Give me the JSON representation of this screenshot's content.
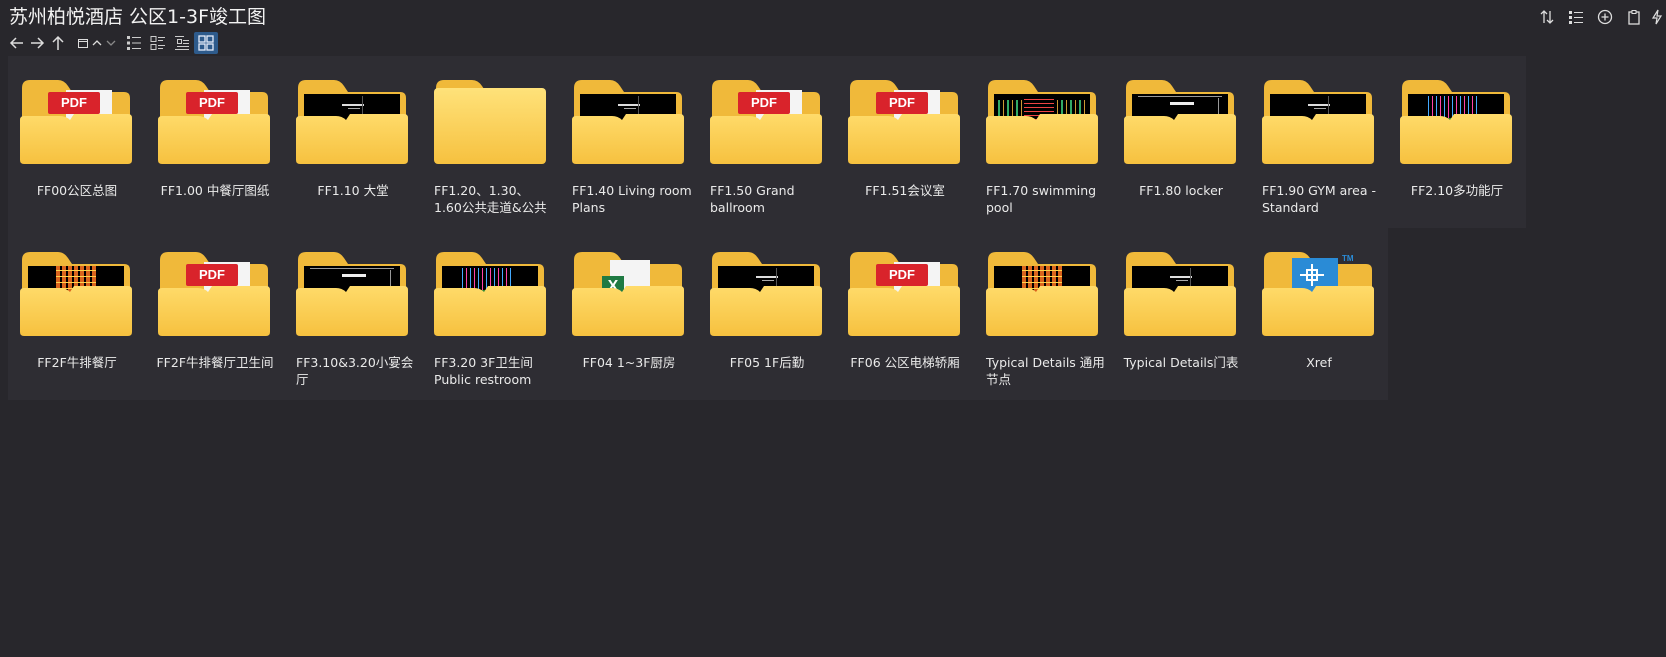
{
  "window": {
    "title": "苏州柏悦酒店 公区1-3F竣工图"
  },
  "navbar": {
    "back_icon": "arrow-left-icon",
    "forward_icon": "arrow-right-icon",
    "up_icon": "arrow-up-icon",
    "views": [
      "details-view-icon",
      "list-view-icon",
      "tiles-view-icon",
      "large-icons-view-icon"
    ]
  },
  "toolbar_right": [
    "sort-icon",
    "checklist-icon",
    "add-circle-icon",
    "clipboard-icon",
    "lightning-icon"
  ],
  "colors": {
    "background": "#28272c",
    "tile": "#2e2d33",
    "folder": "#f7c748",
    "accent": "#2e5b8c",
    "pdf": "#d9232b"
  },
  "items": [
    {
      "label": "FF00公区总图",
      "thumb": "pdf"
    },
    {
      "label": "FF1.00 中餐厅图纸",
      "thumb": "pdf"
    },
    {
      "label": "FF1.10 大堂",
      "thumb": "dark"
    },
    {
      "label": "FF1.20、1.30、1.60公共走道&公共卫...",
      "thumb": "none"
    },
    {
      "label": "FF1.40 Living room Plans",
      "thumb": "dark"
    },
    {
      "label": "FF1.50 Grand ballroom",
      "thumb": "pdf"
    },
    {
      "label": "FF1.51会议室",
      "thumb": "pdf"
    },
    {
      "label": "FF1.70 swimming pool",
      "thumb": "cad-color"
    },
    {
      "label": "FF1.80 locker",
      "thumb": "dark-white"
    },
    {
      "label": "FF1.90 GYM area - Standard",
      "thumb": "dark"
    },
    {
      "label": "FF2.10多功能厅",
      "thumb": "cad-blue"
    },
    {
      "label": "FF2F牛排餐厅",
      "thumb": "cad-orange"
    },
    {
      "label": "FF2F牛排餐厅卫生间",
      "thumb": "pdf"
    },
    {
      "label": "FF3.10&3.20小宴会厅",
      "thumb": "dark-white"
    },
    {
      "label": "FF3.20 3F卫生间 Public restroom",
      "thumb": "cad-blue"
    },
    {
      "label": "FF04 1~3F厨房",
      "thumb": "excel"
    },
    {
      "label": "FF05 1F后勤",
      "thumb": "dark"
    },
    {
      "label": "FF06 公区电梯轿厢",
      "thumb": "pdf"
    },
    {
      "label": "Typical Details 通用节点",
      "thumb": "cad-orange"
    },
    {
      "label": "Typical Details门表",
      "thumb": "dark"
    },
    {
      "label": "Xref",
      "thumb": "autocad"
    }
  ]
}
